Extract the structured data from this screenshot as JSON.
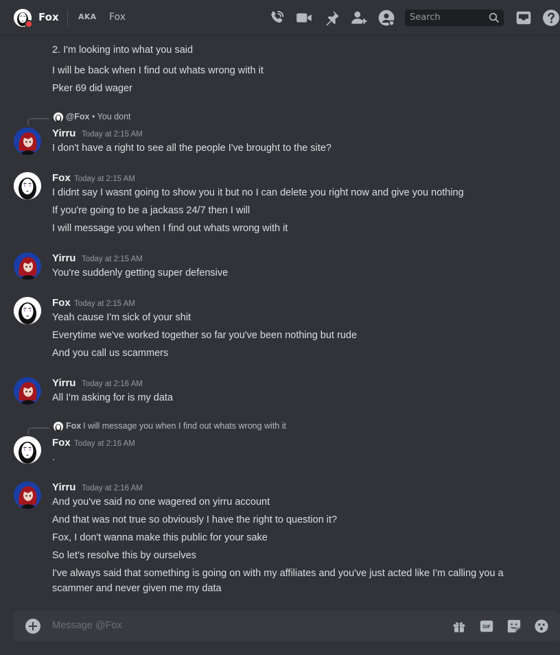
{
  "header": {
    "user_name": "Fox",
    "aka_label": "AKA",
    "aka_name": "Fox",
    "search_placeholder": "Search",
    "icons": [
      "phone-call-icon",
      "video-call-icon",
      "pin-icon",
      "add-friend-icon",
      "user-profile-icon",
      "inbox-icon",
      "help-icon"
    ]
  },
  "messages": {
    "m0": {
      "lines": [
        "2. I'm looking into what you said",
        "I will be back when I find out whats wrong with it",
        "Pker 69 did wager"
      ]
    },
    "m1": {
      "reply_author": "@Fox",
      "reply_text": "• You dont",
      "author": "Yirru",
      "time": "Today at 2:15 AM",
      "lines": [
        "I don't have a right to see all the people I've brought to the site?"
      ]
    },
    "m2": {
      "author": "Fox",
      "time": "Today at 2:15 AM",
      "lines": [
        "I didnt say I wasnt going to show you it but no I can delete you right now and give you nothing",
        "If you're going to be a jackass 24/7 then I will",
        "I will message you when I find out whats wrong with it"
      ]
    },
    "m3": {
      "author": "Yirru",
      "time": "Today at 2:15 AM",
      "lines": [
        "You're suddenly getting super defensive"
      ]
    },
    "m4": {
      "author": "Fox",
      "time": "Today at 2:15 AM",
      "lines": [
        "Yeah cause I'm sick of your shit",
        "Everytime we've worked together so far you've been nothing but rude",
        "And you call us scammers"
      ]
    },
    "m5": {
      "author": "Yirru",
      "time": "Today at 2:16 AM",
      "lines": [
        "All I'm asking for is my data"
      ]
    },
    "m6": {
      "reply_author": "Fox",
      "reply_text": "I will message you when I find out whats wrong with it",
      "author": "Fox",
      "time": "Today at 2:16 AM",
      "lines": [
        "."
      ]
    },
    "m7": {
      "author": "Yirru",
      "time": "Today at 2:16 AM",
      "lines": [
        "And you've said no one wagered on yirru account",
        "And that was not true so obviously I have the right to question it?",
        "Fox, I don't wanna make this public for your sake",
        "So let's resolve this by ourselves",
        "I've always said that something is going on with my affiliates and you've just acted like I'm calling you a",
        "scammer and never given me my data"
      ]
    }
  },
  "composer": {
    "placeholder": "Message @Fox",
    "gif_label": "GIF",
    "icons": [
      "add-attachment-icon",
      "gift-icon",
      "gif-icon",
      "sticker-icon",
      "emoji-icon"
    ]
  },
  "colors": {
    "background": "#313338",
    "header": "#313338",
    "composer": "#383a40",
    "text": "#dbdee1",
    "muted": "#949ba4",
    "status_dnd": "#f23f43"
  }
}
